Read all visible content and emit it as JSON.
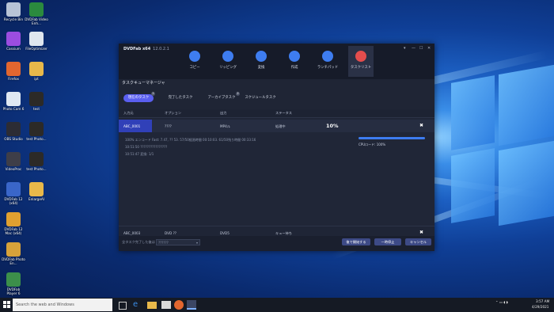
{
  "desktop": {
    "icons": [
      {
        "label": "Recycle Bin",
        "name": "recycle-bin-icon",
        "color": "#b8c4d6"
      },
      {
        "label": "DVDFab Video Enh...",
        "name": "dvdfab-video-enhancer-icon",
        "color": "#2b8a3e"
      },
      {
        "label": "Cassium",
        "name": "cassium-icon",
        "color": "#9b4de0"
      },
      {
        "label": "FileOptimizer",
        "name": "fileoptimizer-icon",
        "color": "#dfe6ee"
      },
      {
        "label": "Firefox",
        "name": "firefox-icon",
        "color": "#e2662f"
      },
      {
        "label": "ipt",
        "name": "folder-icon",
        "color": "#e8b84a"
      },
      {
        "label": "Photo Cam 6",
        "name": "photo-cam-icon",
        "color": "#dfe8f2"
      },
      {
        "label": "test",
        "name": "test-image-icon",
        "color": "#2c2a27"
      },
      {
        "label": "OBS Studio",
        "name": "obs-studio-icon",
        "color": "#2c2c34"
      },
      {
        "label": "test Photo...",
        "name": "test-photo-icon",
        "color": "#2c2a27"
      },
      {
        "label": "VideoProc",
        "name": "videoproc-icon",
        "color": "#3e3e48"
      },
      {
        "label": "test Photo...",
        "name": "test-photo-icon-2",
        "color": "#2c2a27"
      },
      {
        "label": "DVDFab 12 (x64)",
        "name": "dvdfab-12-icon",
        "color": "#3a66c9"
      },
      {
        "label": "EnlargeAI",
        "name": "enlargeai-folder-icon",
        "color": "#e8b84a"
      },
      {
        "label": "DVDFab 12 Mac (x64)",
        "name": "dvdfab-12-mac-icon",
        "color": "#e0a030"
      },
      {
        "label": "DVDFab Photo En...",
        "name": "dvdfab-photo-enhancer-icon",
        "color": "#d7a23a"
      },
      {
        "label": "DVDFab Player 6",
        "name": "dvdfab-player-icon",
        "color": "#3c8f4a"
      }
    ]
  },
  "app": {
    "title": "DVDFab x64",
    "version": "12.0.2.1",
    "window_controls": [
      "▾",
      "—",
      "☐",
      "✕"
    ],
    "toolbar": [
      {
        "label": "コピー",
        "name": "copy-tool",
        "color": "#3e7df0"
      },
      {
        "label": "リッピング",
        "name": "ripper-tool",
        "color": "#3e7df0"
      },
      {
        "label": "変換",
        "name": "converter-tool",
        "color": "#3e7df0"
      },
      {
        "label": "作成",
        "name": "creator-tool",
        "color": "#3e7df0"
      },
      {
        "label": "ランチパッド",
        "name": "launchpad-tool",
        "color": "#3e7df0"
      },
      {
        "label": "タスクリスト",
        "name": "task-list-tool",
        "color": "#e44d4d"
      }
    ],
    "section_title": "タスクキューマネージャ",
    "tabs": [
      {
        "label": "現在のタスク",
        "badge": "2"
      },
      {
        "label": "完了したタスク",
        "badge": ""
      },
      {
        "label": "アーカイブタスク",
        "badge": "2"
      },
      {
        "label": "スケジュールタスク",
        "badge": ""
      }
    ],
    "table": {
      "headers": [
        "入力元",
        "オプション",
        "出力",
        "ステータス"
      ],
      "rows": [
        {
          "source": "ABC_0001",
          "option": "????",
          "output": "MP4ル",
          "status": "処理中",
          "percent": "10%"
        },
        {
          "source": "ABC_0003",
          "option": "DVD ??",
          "output": "DVD5",
          "status": "キュー待ち",
          "percent": ""
        }
      ],
      "log_lines": [
        "100% エンコード Fast: 7.47, ?? 53. 57/50経過時間 00:10:03. 61/50残り時間 00:33:16",
        "10:51:50 ????????????????",
        "10:51:47 変換: 1/1"
      ],
      "cpu_label": "CPUロード: 100%",
      "progress_fraction": 1.0
    },
    "footer": {
      "label": "全タスク完了した後は",
      "select_value": "??????",
      "buttons": [
        "後で開始する",
        "一時停止",
        "キャンセル"
      ]
    }
  },
  "taskbar": {
    "search_placeholder": "Search the web and Windows",
    "time": "3:57 AM",
    "date": "4/29/2021"
  }
}
